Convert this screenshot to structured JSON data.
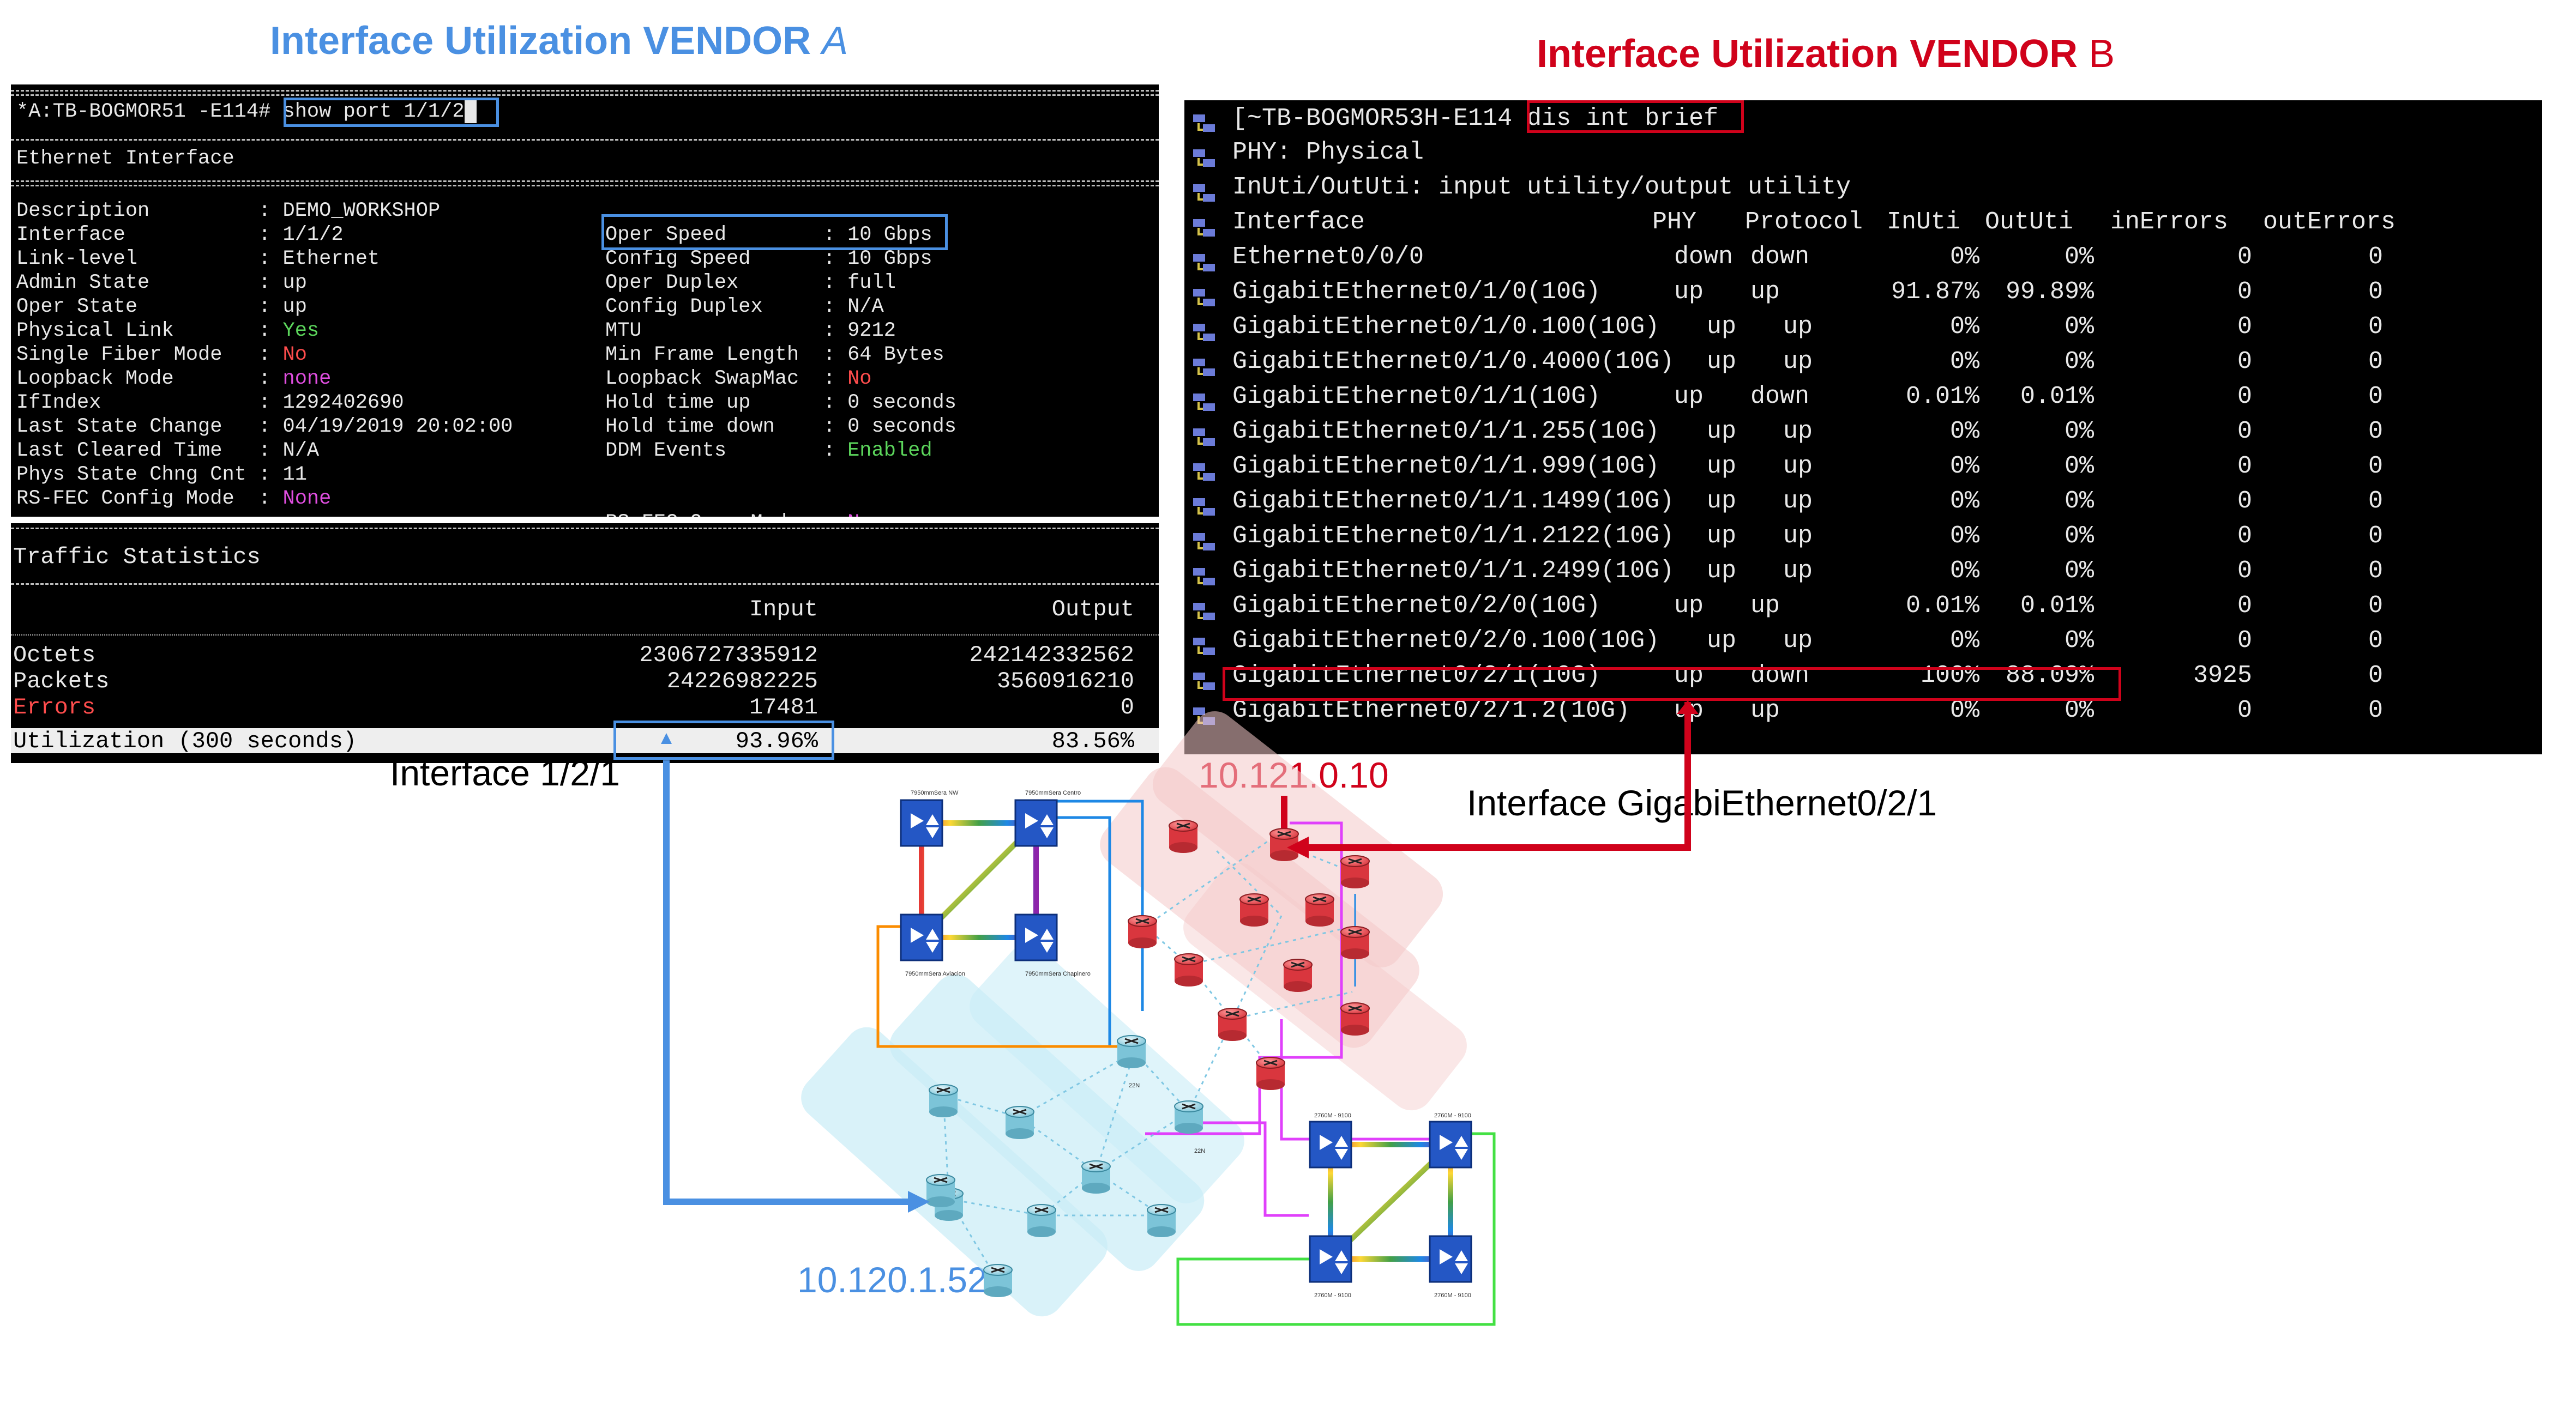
{
  "titles": {
    "vendor_a_prefix": "Interface Utilization VENDOR ",
    "vendor_a_letter": "A",
    "vendor_b_prefix": "Interface Utilization VENDOR ",
    "vendor_b_letter": "B",
    "color_a": "#4a90e2",
    "color_b": "#d0021b"
  },
  "term_a": {
    "prompt": "*A:TB-BOGMOR51 -E114# ",
    "command": "show port 1/1/2",
    "section": "Ethernet Interface",
    "left": [
      {
        "k": "Description        ",
        "v": "DEMO_WORKSHOP",
        "c": "#e8e8e8"
      },
      {
        "k": "Interface          ",
        "v": "1/1/2",
        "c": "#e8e8e8"
      },
      {
        "k": "Link-level         ",
        "v": "Ethernet",
        "c": "#e8e8e8"
      },
      {
        "k": "Admin State        ",
        "v": "up",
        "c": "#e8e8e8"
      },
      {
        "k": "Oper State         ",
        "v": "up",
        "c": "#e8e8e8"
      },
      {
        "k": "Physical Link      ",
        "v": "Yes",
        "c": "#5cd65c"
      },
      {
        "k": "Single Fiber Mode  ",
        "v": "No",
        "c": "#ff4d4d"
      },
      {
        "k": "Loopback Mode      ",
        "v": "none",
        "c": "#e04ee0"
      },
      {
        "k": "IfIndex            ",
        "v": "1292402690",
        "c": "#e8e8e8"
      },
      {
        "k": "Last State Change  ",
        "v": "04/19/2019 20:02:00",
        "c": "#e8e8e8"
      },
      {
        "k": "Last Cleared Time  ",
        "v": "N/A",
        "c": "#e8e8e8"
      },
      {
        "k": "Phys State Chng Cnt",
        "v": "11",
        "c": "#e8e8e8"
      },
      {
        "k": "RS-FEC Config Mode ",
        "v": "None",
        "c": "#e04ee0"
      }
    ],
    "right": [
      {
        "k": "Oper Speed       ",
        "v": "10 Gbps",
        "c": "#e8e8e8"
      },
      {
        "k": "Config Speed     ",
        "v": "10 Gbps",
        "c": "#e8e8e8"
      },
      {
        "k": "Oper Duplex      ",
        "v": "full",
        "c": "#e8e8e8"
      },
      {
        "k": "Config Duplex    ",
        "v": "N/A",
        "c": "#e8e8e8"
      },
      {
        "k": "MTU              ",
        "v": "9212",
        "c": "#e8e8e8"
      },
      {
        "k": "Min Frame Length ",
        "v": "64 Bytes",
        "c": "#e8e8e8"
      },
      {
        "k": "Loopback SwapMac ",
        "v": "No",
        "c": "#ff4d4d"
      },
      {
        "k": "Hold time up     ",
        "v": "0 seconds",
        "c": "#e8e8e8"
      },
      {
        "k": "Hold time down   ",
        "v": "0 seconds",
        "c": "#e8e8e8"
      },
      {
        "k": "DDM Events       ",
        "v": "Enabled",
        "c": "#5cd65c"
      },
      {
        "k": "",
        "v": "",
        "c": "#e8e8e8"
      },
      {
        "k": "",
        "v": "",
        "c": "#e8e8e8"
      },
      {
        "k": "RS-FEC Oper Mode ",
        "v": "None",
        "c": "#e04ee0"
      }
    ]
  },
  "term_traffic": {
    "section": "Traffic Statistics",
    "col_input": "Input",
    "col_output": "Output",
    "rows": [
      {
        "label": "Octets",
        "input": "2306727335912",
        "output": "242142332562",
        "c": "#e8e8e8"
      },
      {
        "label": "Packets",
        "input": "24226982225",
        "output": "3560916210",
        "c": "#e8e8e8"
      },
      {
        "label": "Errors",
        "input": "17481",
        "output": "0",
        "c": "#ff4d4d"
      }
    ],
    "util_label": "Utilization (300 seconds)",
    "util_input": "93.96%",
    "util_output": "83.56%"
  },
  "term_b": {
    "prompt": "[~TB-BOGMOR53H-E114",
    "command": "dis int brief",
    "line1": "PHY: Physical",
    "line2": "InUti/OutUti: input utility/output utility",
    "headers": [
      "Interface",
      "PHY",
      "Protocol",
      "InUti",
      "OutUti",
      "inErrors",
      "outErrors"
    ],
    "rows": [
      [
        "Ethernet0/0/0",
        "down",
        "down",
        "0%",
        "0%",
        "0",
        "0"
      ],
      [
        "GigabitEthernet0/1/0(10G)",
        "up",
        "up",
        "91.87%",
        "99.89%",
        "0",
        "0"
      ],
      [
        "GigabitEthernet0/1/0.100(10G)",
        "up",
        "up",
        "0%",
        "0%",
        "0",
        "0"
      ],
      [
        "GigabitEthernet0/1/0.4000(10G)",
        "up",
        "up",
        "0%",
        "0%",
        "0",
        "0"
      ],
      [
        "GigabitEthernet0/1/1(10G)",
        "up",
        "down",
        "0.01%",
        "0.01%",
        "0",
        "0"
      ],
      [
        "GigabitEthernet0/1/1.255(10G)",
        "up",
        "up",
        "0%",
        "0%",
        "0",
        "0"
      ],
      [
        "GigabitEthernet0/1/1.999(10G)",
        "up",
        "up",
        "0%",
        "0%",
        "0",
        "0"
      ],
      [
        "GigabitEthernet0/1/1.1499(10G)",
        "up",
        "up",
        "0%",
        "0%",
        "0",
        "0"
      ],
      [
        "GigabitEthernet0/1/1.2122(10G)",
        "up",
        "up",
        "0%",
        "0%",
        "0",
        "0"
      ],
      [
        "GigabitEthernet0/1/1.2499(10G)",
        "up",
        "up",
        "0%",
        "0%",
        "0",
        "0"
      ],
      [
        "GigabitEthernet0/2/0(10G)",
        "up",
        "up",
        "0.01%",
        "0.01%",
        "0",
        "0"
      ],
      [
        "GigabitEthernet0/2/0.100(10G)",
        "up",
        "up",
        "0%",
        "0%",
        "0",
        "0"
      ],
      [
        "GigabitEthernet0/2/1(10G)",
        "up",
        "down",
        "100%",
        "88.09%",
        "3925",
        "0"
      ],
      [
        "GigabitEthernet0/2/1.2(10G)",
        "up",
        "up",
        "0%",
        "0%",
        "0",
        "0"
      ]
    ]
  },
  "annotations": {
    "iface_a": "Interface 1/2/1",
    "iface_b": "Interface GigabiEthernet0/2/1",
    "ip_b": "10.121.0.10",
    "ip_a": "10.120.1.52"
  },
  "topology": {
    "top_labels": [
      "7950mmSera NW",
      "7950mmSera Centro",
      "7950mmSera Aviacion",
      "7950mmSera Chapinero"
    ],
    "bottom_labels": [
      "2760M - 9100",
      "2760M - 9100",
      "2760M - 9100",
      "2760M - 9100"
    ],
    "mid_labels": [
      "22N",
      "22N"
    ]
  }
}
